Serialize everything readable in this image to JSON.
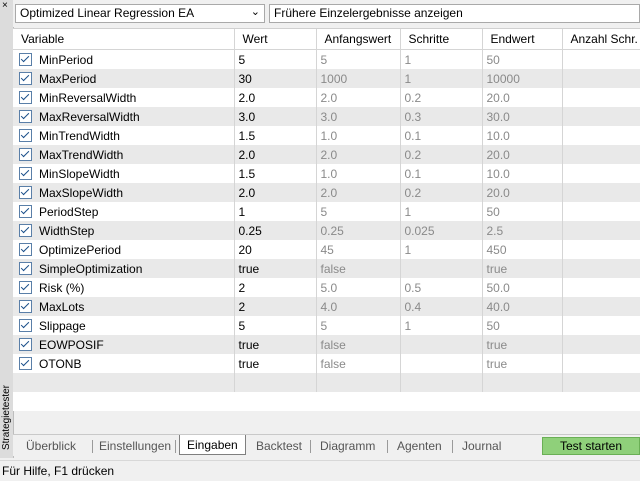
{
  "sidebar": {
    "close_glyph": "×",
    "title": "Strategietester"
  },
  "top": {
    "expert": "Optimized Linear Regression EA",
    "dropdown_icon": "chevron-down-icon",
    "previous_results": "Frühere Einzelergebnisse anzeigen"
  },
  "columns": [
    "Variable",
    "Wert",
    "Anfangswert",
    "Schritte",
    "Endwert",
    "Anzahl Schr."
  ],
  "rows": [
    {
      "name": "MinPeriod",
      "value": "5",
      "start": "5",
      "step": "1",
      "end": "50"
    },
    {
      "name": "MaxPeriod",
      "value": "30",
      "start": "1000",
      "step": "1",
      "end": "10000"
    },
    {
      "name": "MinReversalWidth",
      "value": "2.0",
      "start": "2.0",
      "step": "0.2",
      "end": "20.0"
    },
    {
      "name": "MaxReversalWidth",
      "value": "3.0",
      "start": "3.0",
      "step": "0.3",
      "end": "30.0"
    },
    {
      "name": "MinTrendWidth",
      "value": "1.5",
      "start": "1.0",
      "step": "0.1",
      "end": "10.0"
    },
    {
      "name": "MaxTrendWidth",
      "value": "2.0",
      "start": "2.0",
      "step": "0.2",
      "end": "20.0"
    },
    {
      "name": "MinSlopeWidth",
      "value": "1.5",
      "start": "1.0",
      "step": "0.1",
      "end": "10.0"
    },
    {
      "name": "MaxSlopeWidth",
      "value": "2.0",
      "start": "2.0",
      "step": "0.2",
      "end": "20.0"
    },
    {
      "name": "PeriodStep",
      "value": "1",
      "start": "5",
      "step": "1",
      "end": "50"
    },
    {
      "name": "WidthStep",
      "value": "0.25",
      "start": "0.25",
      "step": "0.025",
      "end": "2.5"
    },
    {
      "name": "OptimizePeriod",
      "value": "20",
      "start": "45",
      "step": "1",
      "end": "450"
    },
    {
      "name": "SimpleOptimization",
      "value": "true",
      "start": "false",
      "step": "",
      "end": "true"
    },
    {
      "name": "Risk (%)",
      "value": "2",
      "start": "5.0",
      "step": "0.5",
      "end": "50.0"
    },
    {
      "name": "MaxLots",
      "value": "2",
      "start": "4.0",
      "step": "0.4",
      "end": "40.0"
    },
    {
      "name": "Slippage",
      "value": "5",
      "start": "5",
      "step": "1",
      "end": "50"
    },
    {
      "name": "EOWPOSIF",
      "value": "true",
      "start": "false",
      "step": "",
      "end": "true"
    },
    {
      "name": "OTONB",
      "value": "true",
      "start": "false",
      "step": "",
      "end": "true"
    }
  ],
  "tabs": [
    "Überblick",
    "Einstellungen",
    "Eingaben",
    "Backtest",
    "Diagramm",
    "Agenten",
    "Journal"
  ],
  "active_tab": "Eingaben",
  "start_button": "Test starten",
  "status": "Für Hilfe, F1 drücken",
  "colors": {
    "start_button": "#8fd07a",
    "row_alt": "#e9e9e9"
  }
}
